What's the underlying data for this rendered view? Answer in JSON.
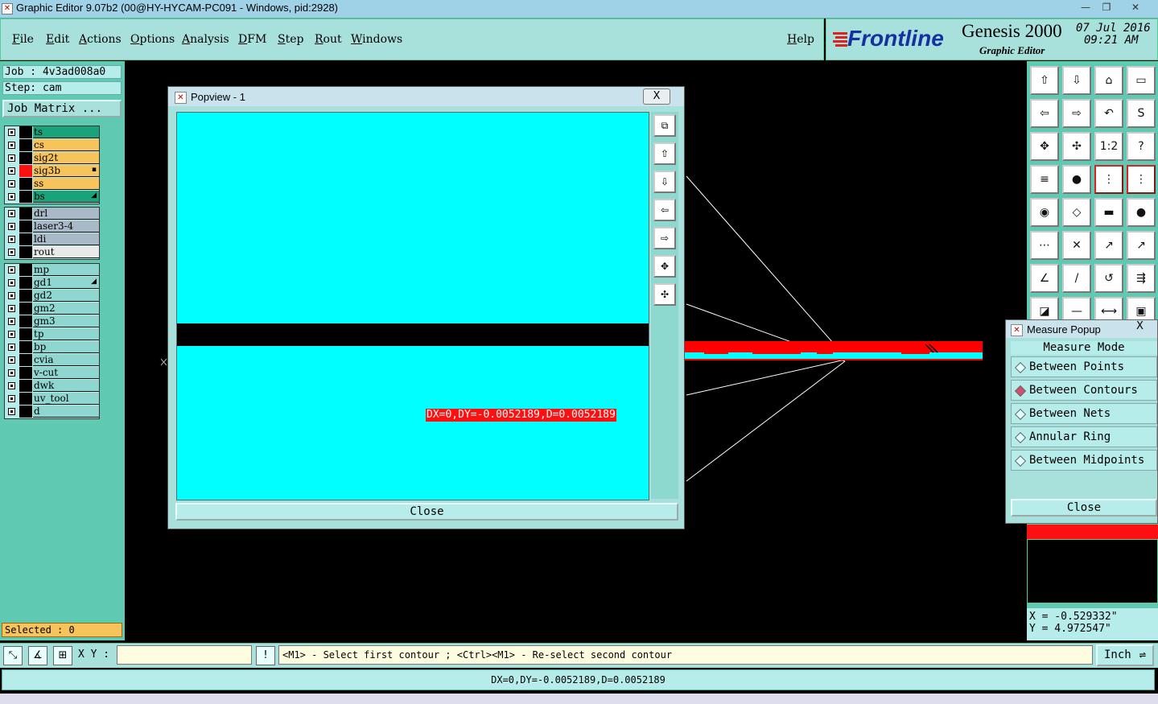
{
  "window": {
    "title": "Graphic Editor 9.07b2 (00@HY-HYCAM-PC091 - Windows, pid:2928)",
    "minimize_icon": "minimize-icon",
    "maximize_icon": "maximize-icon",
    "close_icon": "close-icon"
  },
  "menu": {
    "items": [
      "File",
      "Edit",
      "Actions",
      "Options",
      "Analysis",
      "DFM",
      "Step",
      "Rout",
      "Windows"
    ],
    "help": "Help"
  },
  "brand": {
    "logo": "Frontline",
    "product": "Genesis 2000",
    "subtitle": "Graphic Editor",
    "date": "07 Jul 2016",
    "time": "09:21 AM"
  },
  "job": {
    "job_label": "Job : 4v3ad008a0",
    "step_label": "Step: cam",
    "matrix_button": "Job Matrix ..."
  },
  "layers": {
    "group1": [
      {
        "name": "ts",
        "color": "#1aa37a",
        "chip": "#000000",
        "mark": ""
      },
      {
        "name": "cs",
        "color": "#f7c35b",
        "chip": "#000000",
        "mark": ""
      },
      {
        "name": "sig2t",
        "color": "#f7c35b",
        "chip": "#000000",
        "mark": ""
      },
      {
        "name": "sig3b",
        "color": "#f7c35b",
        "chip": "#ff1010",
        "mark": "▪"
      },
      {
        "name": "ss",
        "color": "#f7c35b",
        "chip": "#000000",
        "mark": ""
      },
      {
        "name": "bs",
        "color": "#1aa37a",
        "chip": "#000000",
        "mark": "◢"
      }
    ],
    "group2": [
      {
        "name": "drl",
        "color": "#a9b9c7",
        "chip": "#000000",
        "mark": ""
      },
      {
        "name": "laser3-4",
        "color": "#a9b9c7",
        "chip": "#000000",
        "mark": ""
      },
      {
        "name": "ldi",
        "color": "#a9b9c7",
        "chip": "#000000",
        "mark": ""
      },
      {
        "name": "rout",
        "color": "#e9e9e9",
        "chip": "#000000",
        "mark": ""
      }
    ],
    "group3": [
      {
        "name": "mp",
        "color": "#8fd6d0",
        "chip": "#000000",
        "mark": ""
      },
      {
        "name": "gd1",
        "color": "#8fd6d0",
        "chip": "#000000",
        "mark": "◢"
      },
      {
        "name": "gd2",
        "color": "#8fd6d0",
        "chip": "#000000",
        "mark": ""
      },
      {
        "name": "gm2",
        "color": "#8fd6d0",
        "chip": "#000000",
        "mark": ""
      },
      {
        "name": "gm3",
        "color": "#8fd6d0",
        "chip": "#000000",
        "mark": ""
      },
      {
        "name": "tp",
        "color": "#8fd6d0",
        "chip": "#000000",
        "mark": ""
      },
      {
        "name": "bp",
        "color": "#8fd6d0",
        "chip": "#000000",
        "mark": ""
      },
      {
        "name": "cvia",
        "color": "#8fd6d0",
        "chip": "#000000",
        "mark": ""
      },
      {
        "name": "v-cut",
        "color": "#8fd6d0",
        "chip": "#000000",
        "mark": ""
      },
      {
        "name": "dwk",
        "color": "#8fd6d0",
        "chip": "#000000",
        "mark": ""
      },
      {
        "name": "uv_tool",
        "color": "#8fd6d0",
        "chip": "#000000",
        "mark": ""
      },
      {
        "name": "d",
        "color": "#8fd6d0",
        "chip": "#000000",
        "mark": ""
      }
    ]
  },
  "selected": "Selected : 0",
  "popview": {
    "title": "Popview - 1",
    "close_x": "X",
    "measure_label": "DX=0,DY=-0.0052189,D=0.0052189",
    "close_button": "Close"
  },
  "measure_popup": {
    "title": "Measure Popup",
    "close_x": "X",
    "mode_header": "Measure Mode",
    "options": [
      "Between Points",
      "Between Contours",
      "Between Nets",
      "Annular Ring",
      "Between Midpoints"
    ],
    "selected_index": 1,
    "close_button": "Close"
  },
  "coords": {
    "x": "X = -0.529332\"",
    "y": "Y = 4.972547\""
  },
  "status": {
    "xy_label": "X Y :",
    "xy_value": "",
    "prompt": "<M1> - Select first contour ; <Ctrl><M1> - Re-select second contour",
    "unit": "Inch",
    "message": "DX=0,DY=-0.0052189,D=0.0052189"
  },
  "toolbar_icons": [
    "pan-up-icon",
    "pan-down-icon",
    "home-icon",
    "window-icon",
    "pan-left-icon",
    "pan-right-icon",
    "undo-view-icon",
    "redraw-icon",
    "zoom-fit-icon",
    "zoom-center-icon",
    "ratio-1-2-icon",
    "help-icon",
    "snap-icon",
    "probe-icon",
    "net-icon",
    "net-select-icon",
    "pad-icon",
    "shape-icon",
    "ruler-icon",
    "dot-icon",
    "connect-icon",
    "cross-icon",
    "move-icon",
    "point-icon",
    "angle-icon",
    "line-icon",
    "arc-icon",
    "feature-icon",
    "select-icon",
    "dash-icon",
    "resize-icon",
    "layers-icon"
  ],
  "toolbar_glyphs": [
    "⇧",
    "⇩",
    "⌂",
    "▭",
    "⇦",
    "⇨",
    "↶",
    "S",
    "✥",
    "✣",
    "1:2",
    "?",
    "≡",
    "●",
    "⋮",
    "⋮",
    "◉",
    "◇",
    "▬",
    "●",
    "⋯",
    "✕",
    "↗",
    "↗",
    "∠",
    "/",
    "↺",
    "⇶",
    "◪",
    "—",
    "⟷",
    "▣"
  ]
}
